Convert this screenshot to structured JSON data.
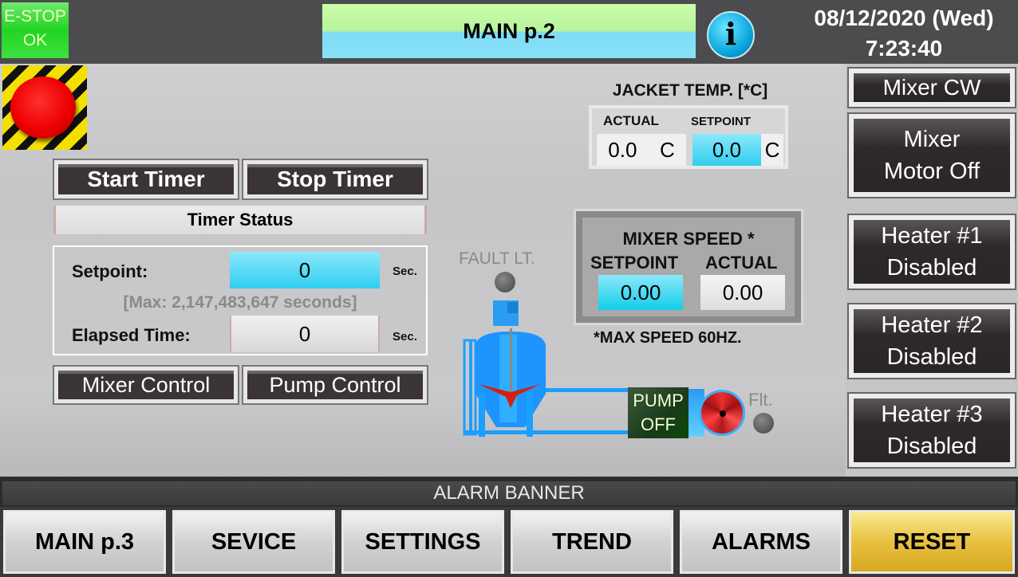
{
  "header": {
    "estop": "E-STOP OK",
    "estop_line1": "E-STOP",
    "estop_line2": "OK",
    "title": "MAIN p.2",
    "info_icon": "i",
    "date": "08/12/2020 (Wed)",
    "time": "7:23:40"
  },
  "timer": {
    "start_label": "Start Timer",
    "stop_label": "Stop Timer",
    "status_label": "Timer Status",
    "setpoint_label": "Setpoint:",
    "setpoint_value": "0",
    "setpoint_unit": "Sec.",
    "max_note": "[Max: 2,147,483,647 seconds]",
    "elapsed_label": "Elapsed Time:",
    "elapsed_value": "0",
    "elapsed_unit": "Sec."
  },
  "controls": {
    "mixer_control": "Mixer Control",
    "pump_control": "Pump Control"
  },
  "jacket": {
    "title": "JACKET TEMP. [*C]",
    "actual_label": "ACTUAL",
    "setpoint_label": "SETPOINT",
    "actual_value": "0.0",
    "actual_unit": "C",
    "setpoint_value": "0.0",
    "setpoint_unit": "C"
  },
  "mixer_speed": {
    "title": "MIXER SPEED *",
    "setpoint_label": "SETPOINT",
    "actual_label": "ACTUAL",
    "setpoint_value": "0.00",
    "actual_value": "0.00",
    "note": "*MAX SPEED 60HZ."
  },
  "process": {
    "fault_label": "FAULT LT.",
    "pump_line1": "PUMP",
    "pump_line2": "OFF",
    "flt_label": "Flt."
  },
  "right_buttons": [
    {
      "line1": "Mixer CW"
    },
    {
      "line1": "Mixer",
      "line2": "Motor Off"
    },
    {
      "line1": "Heater #1",
      "line2": "Disabled"
    },
    {
      "line1": "Heater #2",
      "line2": "Disabled"
    },
    {
      "line1": "Heater #3",
      "line2": "Disabled"
    }
  ],
  "alarm_banner": "ALARM BANNER",
  "nav": [
    "MAIN p.3",
    "SEVICE",
    "SETTINGS",
    "TREND",
    "ALARMS",
    "RESET"
  ],
  "colors": {
    "accent_cyan": "#3fd6f2",
    "estop_green": "#22d422",
    "reset_gold": "#e8c040"
  }
}
